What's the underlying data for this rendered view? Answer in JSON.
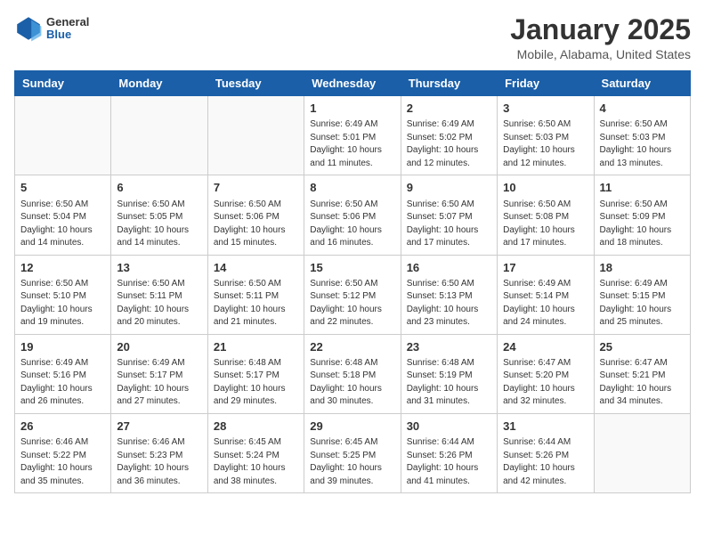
{
  "header": {
    "logo": {
      "general": "General",
      "blue": "Blue"
    },
    "title": "January 2025",
    "location": "Mobile, Alabama, United States"
  },
  "weekdays": [
    "Sunday",
    "Monday",
    "Tuesday",
    "Wednesday",
    "Thursday",
    "Friday",
    "Saturday"
  ],
  "weeks": [
    [
      {
        "day": "",
        "info": ""
      },
      {
        "day": "",
        "info": ""
      },
      {
        "day": "",
        "info": ""
      },
      {
        "day": "1",
        "info": "Sunrise: 6:49 AM\nSunset: 5:01 PM\nDaylight: 10 hours\nand 11 minutes."
      },
      {
        "day": "2",
        "info": "Sunrise: 6:49 AM\nSunset: 5:02 PM\nDaylight: 10 hours\nand 12 minutes."
      },
      {
        "day": "3",
        "info": "Sunrise: 6:50 AM\nSunset: 5:03 PM\nDaylight: 10 hours\nand 12 minutes."
      },
      {
        "day": "4",
        "info": "Sunrise: 6:50 AM\nSunset: 5:03 PM\nDaylight: 10 hours\nand 13 minutes."
      }
    ],
    [
      {
        "day": "5",
        "info": "Sunrise: 6:50 AM\nSunset: 5:04 PM\nDaylight: 10 hours\nand 14 minutes."
      },
      {
        "day": "6",
        "info": "Sunrise: 6:50 AM\nSunset: 5:05 PM\nDaylight: 10 hours\nand 14 minutes."
      },
      {
        "day": "7",
        "info": "Sunrise: 6:50 AM\nSunset: 5:06 PM\nDaylight: 10 hours\nand 15 minutes."
      },
      {
        "day": "8",
        "info": "Sunrise: 6:50 AM\nSunset: 5:06 PM\nDaylight: 10 hours\nand 16 minutes."
      },
      {
        "day": "9",
        "info": "Sunrise: 6:50 AM\nSunset: 5:07 PM\nDaylight: 10 hours\nand 17 minutes."
      },
      {
        "day": "10",
        "info": "Sunrise: 6:50 AM\nSunset: 5:08 PM\nDaylight: 10 hours\nand 17 minutes."
      },
      {
        "day": "11",
        "info": "Sunrise: 6:50 AM\nSunset: 5:09 PM\nDaylight: 10 hours\nand 18 minutes."
      }
    ],
    [
      {
        "day": "12",
        "info": "Sunrise: 6:50 AM\nSunset: 5:10 PM\nDaylight: 10 hours\nand 19 minutes."
      },
      {
        "day": "13",
        "info": "Sunrise: 6:50 AM\nSunset: 5:11 PM\nDaylight: 10 hours\nand 20 minutes."
      },
      {
        "day": "14",
        "info": "Sunrise: 6:50 AM\nSunset: 5:11 PM\nDaylight: 10 hours\nand 21 minutes."
      },
      {
        "day": "15",
        "info": "Sunrise: 6:50 AM\nSunset: 5:12 PM\nDaylight: 10 hours\nand 22 minutes."
      },
      {
        "day": "16",
        "info": "Sunrise: 6:50 AM\nSunset: 5:13 PM\nDaylight: 10 hours\nand 23 minutes."
      },
      {
        "day": "17",
        "info": "Sunrise: 6:49 AM\nSunset: 5:14 PM\nDaylight: 10 hours\nand 24 minutes."
      },
      {
        "day": "18",
        "info": "Sunrise: 6:49 AM\nSunset: 5:15 PM\nDaylight: 10 hours\nand 25 minutes."
      }
    ],
    [
      {
        "day": "19",
        "info": "Sunrise: 6:49 AM\nSunset: 5:16 PM\nDaylight: 10 hours\nand 26 minutes."
      },
      {
        "day": "20",
        "info": "Sunrise: 6:49 AM\nSunset: 5:17 PM\nDaylight: 10 hours\nand 27 minutes."
      },
      {
        "day": "21",
        "info": "Sunrise: 6:48 AM\nSunset: 5:17 PM\nDaylight: 10 hours\nand 29 minutes."
      },
      {
        "day": "22",
        "info": "Sunrise: 6:48 AM\nSunset: 5:18 PM\nDaylight: 10 hours\nand 30 minutes."
      },
      {
        "day": "23",
        "info": "Sunrise: 6:48 AM\nSunset: 5:19 PM\nDaylight: 10 hours\nand 31 minutes."
      },
      {
        "day": "24",
        "info": "Sunrise: 6:47 AM\nSunset: 5:20 PM\nDaylight: 10 hours\nand 32 minutes."
      },
      {
        "day": "25",
        "info": "Sunrise: 6:47 AM\nSunset: 5:21 PM\nDaylight: 10 hours\nand 34 minutes."
      }
    ],
    [
      {
        "day": "26",
        "info": "Sunrise: 6:46 AM\nSunset: 5:22 PM\nDaylight: 10 hours\nand 35 minutes."
      },
      {
        "day": "27",
        "info": "Sunrise: 6:46 AM\nSunset: 5:23 PM\nDaylight: 10 hours\nand 36 minutes."
      },
      {
        "day": "28",
        "info": "Sunrise: 6:45 AM\nSunset: 5:24 PM\nDaylight: 10 hours\nand 38 minutes."
      },
      {
        "day": "29",
        "info": "Sunrise: 6:45 AM\nSunset: 5:25 PM\nDaylight: 10 hours\nand 39 minutes."
      },
      {
        "day": "30",
        "info": "Sunrise: 6:44 AM\nSunset: 5:26 PM\nDaylight: 10 hours\nand 41 minutes."
      },
      {
        "day": "31",
        "info": "Sunrise: 6:44 AM\nSunset: 5:26 PM\nDaylight: 10 hours\nand 42 minutes."
      },
      {
        "day": "",
        "info": ""
      }
    ]
  ]
}
